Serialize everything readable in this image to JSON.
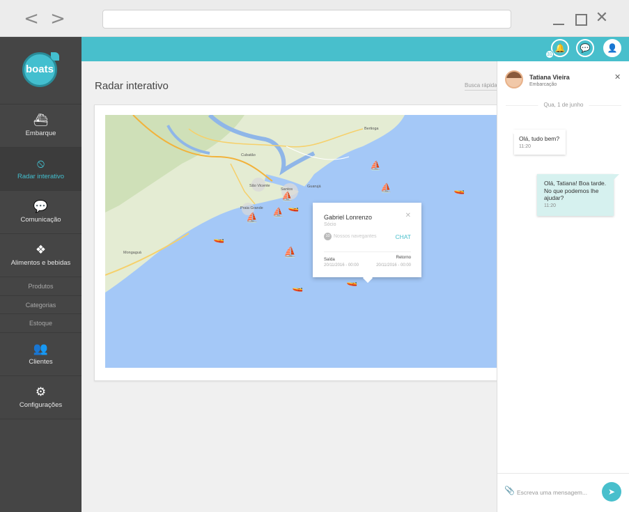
{
  "browser": {
    "back_glyph": "<",
    "forward_glyph": ">",
    "close_glyph": "✕"
  },
  "sidebar": {
    "logo_text": "boats",
    "items": [
      {
        "label": "Embarque",
        "icon": "ship-icon",
        "glyph": "⛴"
      },
      {
        "label": "Radar interativo",
        "icon": "compass-icon",
        "glyph": "⦸"
      },
      {
        "label": "Comunicação",
        "icon": "chat-bubbles-icon",
        "glyph": "💬"
      },
      {
        "label": "Alimentos e bebidas",
        "icon": "dropbox-icon",
        "glyph": "❖"
      }
    ],
    "sub_items": [
      "Produtos",
      "Categorias",
      "Estoque"
    ],
    "items_after": [
      {
        "label": "Clientes",
        "icon": "users-icon",
        "glyph": "👥"
      },
      {
        "label": "Configurações",
        "icon": "gear-icon",
        "glyph": "⚙"
      }
    ]
  },
  "topbar": {
    "notification_count": "31",
    "bell_glyph": "🔔",
    "chat_glyph": "💬",
    "user_glyph": "👤"
  },
  "main": {
    "title": "Radar interativo",
    "quick_search": "Busca rápida"
  },
  "map": {
    "labels": [
      "Bertioga",
      "Cubatão",
      "São Vicente",
      "Santos",
      "Praia Grande",
      "Mongaguá",
      "Guarujá"
    ],
    "popup": {
      "name": "Gabriel Lonrenzo",
      "status": "Sócio",
      "count": "10",
      "count_label": "Nossos navegantes",
      "chat": "CHAT",
      "out_label": "Saída",
      "out_value": "20/11/2016 - 00:00",
      "return_label": "Retorno",
      "return_value": "20/11/2016 - 00:00",
      "close": "✕"
    },
    "land_color": "#e6eed8",
    "water_color": "#a4c8f7"
  },
  "chat": {
    "name": "Tatiana Vieira",
    "role": "Embarcação",
    "close": "✕",
    "date": "Qua, 1 de junho",
    "messages": [
      {
        "text": "Olá, tudo bem?",
        "time": "11:20"
      },
      {
        "text": "Olá, Tatiana! Boa tarde. No que podemos lhe ajudar?",
        "time": "11:20"
      }
    ],
    "input_placeholder": "Escreva uma mensagem...",
    "send_glyph": "➤",
    "clip_glyph": "📎"
  },
  "colors": {
    "accent": "#48bfcc",
    "sidebar": "#454545"
  }
}
